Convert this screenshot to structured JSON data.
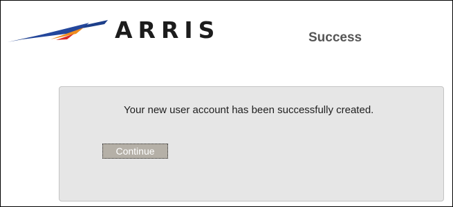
{
  "header": {
    "logo_text": "ARRIS",
    "logo_icon": "arris-swoosh-logo",
    "page_title": "Success"
  },
  "main": {
    "message": "Your new user account has been successfully created.",
    "continue_label": "Continue"
  },
  "colors": {
    "logo_blue": "#1d3f8a",
    "logo_orange": "#f08c1e",
    "logo_red": "#d92a28",
    "panel_background": "#e6e6e6",
    "button_background": "#b5b0a7",
    "heading_text": "#555555"
  }
}
